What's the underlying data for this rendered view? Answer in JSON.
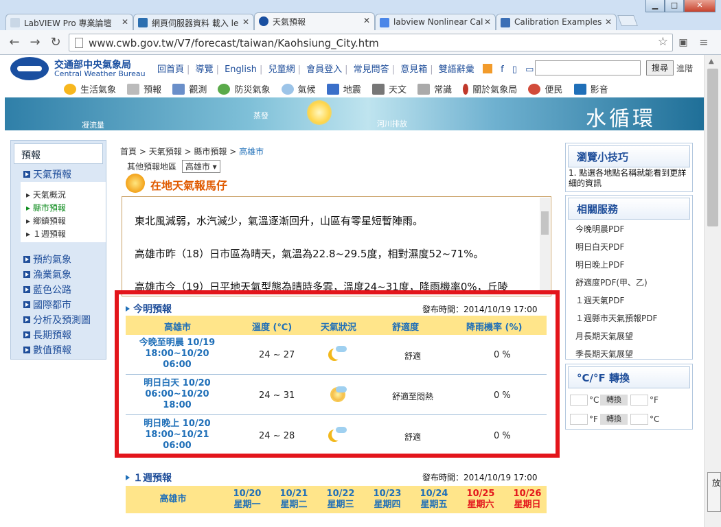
{
  "browser": {
    "tabs": [
      {
        "title": "LabVIEW Pro 專業論壇"
      },
      {
        "title": "網頁伺服器資料 載入 le"
      },
      {
        "title": "天氣預報"
      },
      {
        "title": "labview Nonlinear Cal"
      },
      {
        "title": "Calibration Examples"
      }
    ],
    "url": "www.cwb.gov.tw/V7/forecast/taiwan/Kaohsiung_City.htm"
  },
  "site": {
    "logo_cn": "交通部中央氣象局",
    "logo_en": "Central Weather Bureau",
    "top_links": [
      "回首頁",
      "導覽",
      "English",
      "兒童網",
      "會員登入",
      "常見問答",
      "意見箱",
      "雙語辭彙"
    ],
    "search_button": "搜尋",
    "advanced": "進階",
    "main_nav": [
      "生活氣象",
      "預報",
      "觀測",
      "防災氣象",
      "氣候",
      "地震",
      "天文",
      "常識",
      "關於氣象局",
      "便民",
      "影音"
    ],
    "banner": {
      "title": "水循環",
      "labels": [
        "凝流量",
        "蒸發",
        "河川排放"
      ]
    }
  },
  "left_nav": {
    "header": "預報",
    "active": "天氣預報",
    "sub": [
      "天氣概況",
      "縣市預報",
      "鄉鎮預報",
      "１週預報"
    ],
    "items": [
      "預約氣象",
      "漁業氣象",
      "藍色公路",
      "國際都市",
      "分析及預測圖",
      "長期預報",
      "數值預報"
    ]
  },
  "breadcrumb": {
    "home": "首頁",
    "a": "天氣預報",
    "b": "縣市預報",
    "current": "高雄市"
  },
  "region_label": "其他預報地區",
  "region_value": "高雄市",
  "local_title": "在地天氣報馬仔",
  "summary": [
    "東北風減弱，水汽減少，氣溫逐漸回升，山區有零星短暫陣雨。",
    "高雄市昨（18）日市區為晴天，氣溫為22.8~29.5度，相對濕度52~71%。",
    "高雄市今（19）日平地天氣型態為晴時多雲，溫度24~31度，降雨機率0%，丘陵"
  ],
  "forecast": {
    "title": "今明預報",
    "published": "發布時間：2014/10/19 17:00",
    "headers": [
      "高雄市",
      "溫度 (℃)",
      "天氣狀況",
      "舒適度",
      "降雨機率 (%)"
    ],
    "rows": [
      {
        "period": [
          "今晚至明晨 10/19",
          "18:00~10/20",
          "06:00"
        ],
        "temp": "24 ~ 27",
        "icon": "moon-cloud-icon",
        "comfort": "舒適",
        "rain": "0 %"
      },
      {
        "period": [
          "明日白天 10/20",
          "06:00~10/20",
          "18:00"
        ],
        "temp": "24 ~ 31",
        "icon": "sun-cloud-icon",
        "comfort": "舒適至悶熱",
        "rain": "0 %"
      },
      {
        "period": [
          "明日晚上 10/20",
          "18:00~10/21",
          "06:00"
        ],
        "temp": "24 ~ 28",
        "icon": "moon-cloud-icon",
        "comfort": "舒適",
        "rain": "0 %"
      }
    ]
  },
  "weekly": {
    "title": "１週預報",
    "published": "發布時間：2014/10/19 17:00",
    "city": "高雄市",
    "days": [
      {
        "date": "10/20",
        "weekday": "星期一"
      },
      {
        "date": "10/21",
        "weekday": "星期二"
      },
      {
        "date": "10/22",
        "weekday": "星期三"
      },
      {
        "date": "10/23",
        "weekday": "星期四"
      },
      {
        "date": "10/24",
        "weekday": "星期五"
      },
      {
        "date": "10/25",
        "weekday": "星期六"
      },
      {
        "date": "10/26",
        "weekday": "星期日"
      }
    ]
  },
  "right": {
    "tips_title": "瀏覽小技巧",
    "tip": "1.  點選各地點名稱就能看到更詳細的資訊",
    "services_title": "相關服務",
    "services": [
      "今晚明晨PDF",
      "明日白天PDF",
      "明日晚上PDF",
      "舒適度PDF(甲、乙)",
      "１週天氣PDF",
      "１週縣市天氣預報PDF",
      "月長期天氣展望",
      "季長期天氣展望"
    ],
    "conv_title": "°C/°F 轉換",
    "c": "°C",
    "f": "°F",
    "convert": "轉換"
  },
  "popup": "放"
}
